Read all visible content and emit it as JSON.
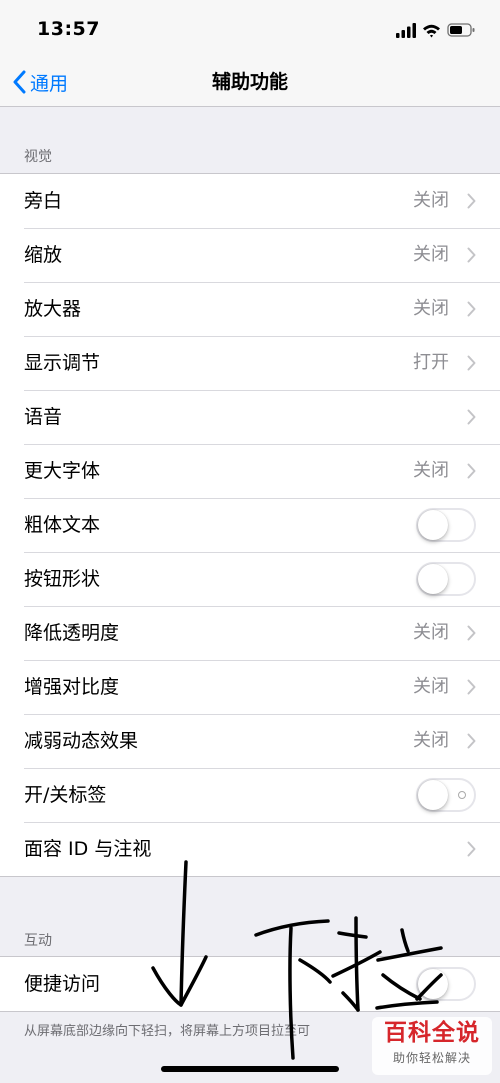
{
  "status_bar": {
    "time": "13:57",
    "icons": [
      "signal-icon",
      "wifi-icon",
      "battery-icon"
    ]
  },
  "nav": {
    "back_label": "通用",
    "title": "辅助功能"
  },
  "vision": {
    "header": "视觉",
    "rows": [
      {
        "label": "旁白",
        "value": "关闭"
      },
      {
        "label": "缩放",
        "value": "关闭"
      },
      {
        "label": "放大器",
        "value": "关闭"
      },
      {
        "label": "显示调节",
        "value": "打开"
      },
      {
        "label": "语音",
        "value": ""
      },
      {
        "label": "更大字体",
        "value": "关闭"
      },
      {
        "label": "粗体文本",
        "toggle": false
      },
      {
        "label": "按钮形状",
        "toggle": false
      },
      {
        "label": "降低透明度",
        "value": "关闭"
      },
      {
        "label": "增强对比度",
        "value": "关闭"
      },
      {
        "label": "减弱动态效果",
        "value": "关闭"
      },
      {
        "label": "开/关标签",
        "toggle": false
      },
      {
        "label": "面容 ID 与注视",
        "value": ""
      }
    ]
  },
  "interaction": {
    "header": "互动",
    "rows": [
      {
        "label": "便捷访问",
        "toggle": false
      }
    ],
    "footer": "从屏幕底部边缘向下轻扫，将屏幕上方项目拉至可"
  },
  "watermark": {
    "title": "百科全说",
    "subtitle": "助你轻松解决"
  },
  "colors": {
    "accent": "#007aff",
    "background": "#efeff4",
    "secondary_text": "#8e8e93",
    "watermark_red": "#d6262b"
  }
}
